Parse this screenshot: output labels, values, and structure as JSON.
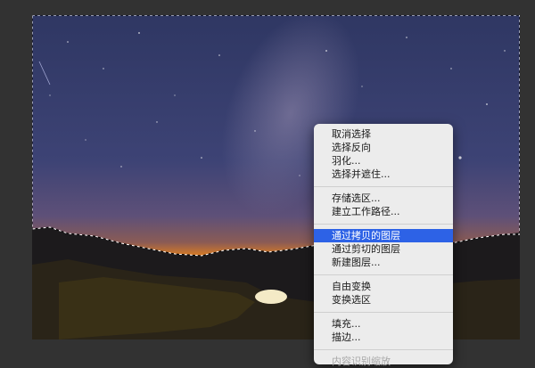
{
  "colors": {
    "menu_background": "#ececec",
    "menu_highlight": "#2d62e6",
    "workspace_background": "#323232"
  },
  "context_menu": {
    "groups": [
      [
        "取消选择",
        "选择反向",
        "羽化...",
        "选择并遮住..."
      ],
      [
        "存储选区...",
        "建立工作路径..."
      ],
      [
        "通过拷贝的图层",
        "通过剪切的图层",
        "新建图层..."
      ],
      [
        "自由变换",
        "变换选区"
      ],
      [
        "填充...",
        "描边..."
      ],
      [
        "内容识别缩放"
      ]
    ],
    "highlighted_item": "通过拷贝的图层"
  }
}
